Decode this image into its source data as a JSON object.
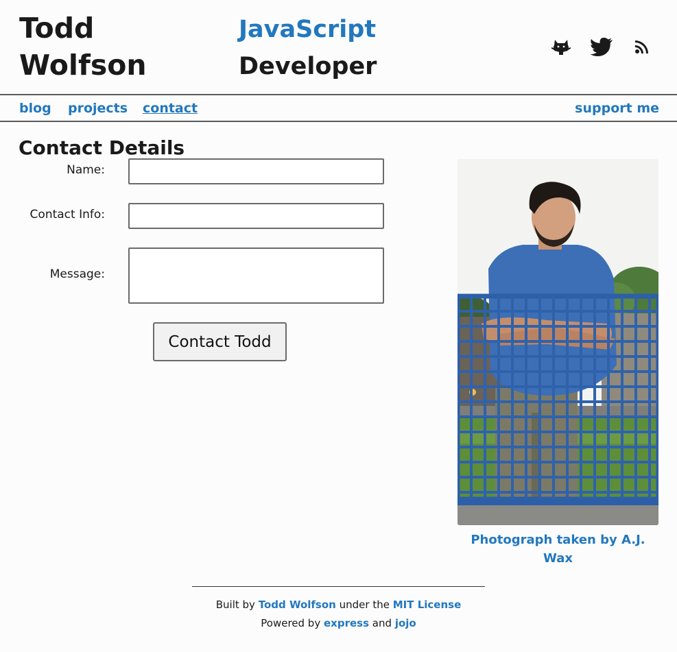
{
  "header": {
    "name_line1": "Todd",
    "name_line2": "Wolfson",
    "tagline_highlight": "JavaScript",
    "tagline_rest": "Developer",
    "social": [
      {
        "icon": "github-octocat-icon"
      },
      {
        "icon": "twitter-bird-icon"
      },
      {
        "icon": "rss-feed-icon"
      }
    ]
  },
  "nav": {
    "blog": "blog",
    "projects": "projects",
    "contact": "contact",
    "support": "support me"
  },
  "contact": {
    "title": "Contact Details",
    "name_label": "Name:",
    "name_value": "",
    "info_label": "Contact Info:",
    "info_value": "",
    "message_label": "Message:",
    "message_value": "",
    "submit": "Contact Todd"
  },
  "photo": {
    "caption": "Photograph taken by A.J. Wax"
  },
  "footer": {
    "built_by": "Built by",
    "author": "Todd Wolfson",
    "under_the": "under the",
    "license": "MIT License",
    "powered_by": "Powered by",
    "express": "express",
    "and": "and",
    "jojo": "jojo"
  },
  "colors": {
    "accent": "#2278be",
    "text": "#1a1a1a",
    "background": "#fcfcfc"
  }
}
